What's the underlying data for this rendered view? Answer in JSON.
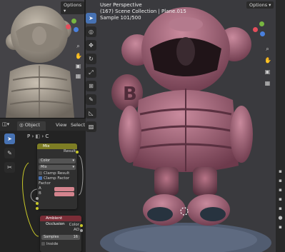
{
  "top_left_viewport": {
    "header": {
      "options": "Options"
    },
    "gizmo": {
      "x": "#e54e5b",
      "y": "#78b641",
      "z": "#4a80dd"
    }
  },
  "main_viewport": {
    "header": {
      "perspective": "User Perspective",
      "collection": "(167) Scene Collection | Plane.015",
      "sample": "Sample 101/500",
      "options": "Options"
    },
    "render_colors": {
      "figure": "#a8677c",
      "shadow": "#4f2b39",
      "ground": "#515c70"
    }
  },
  "node_editor": {
    "header": {
      "object_menu": "Object",
      "view": "View",
      "select": "Select"
    },
    "breadcrumb": {
      "p": "P",
      "c": "C"
    },
    "mix_node": {
      "title": "Mix",
      "output": "Result",
      "data_type": "Color",
      "blend_mode": "Mix",
      "clamp_result": "Clamp Result",
      "clamp_factor": "Clamp Factor",
      "factor": "Factor",
      "a": "A",
      "b": "B",
      "clamp_result_checked": false,
      "clamp_factor_checked": true,
      "title_color": "#7d7d24",
      "swatch_color": "#d4848e"
    },
    "ao_node": {
      "title": "Ambient Occlusion",
      "color_out": "Color",
      "ao_out": "AO",
      "samples_label": "Samples",
      "samples_value": "16",
      "inside": "Inside",
      "title_color": "#7a2d37"
    }
  }
}
